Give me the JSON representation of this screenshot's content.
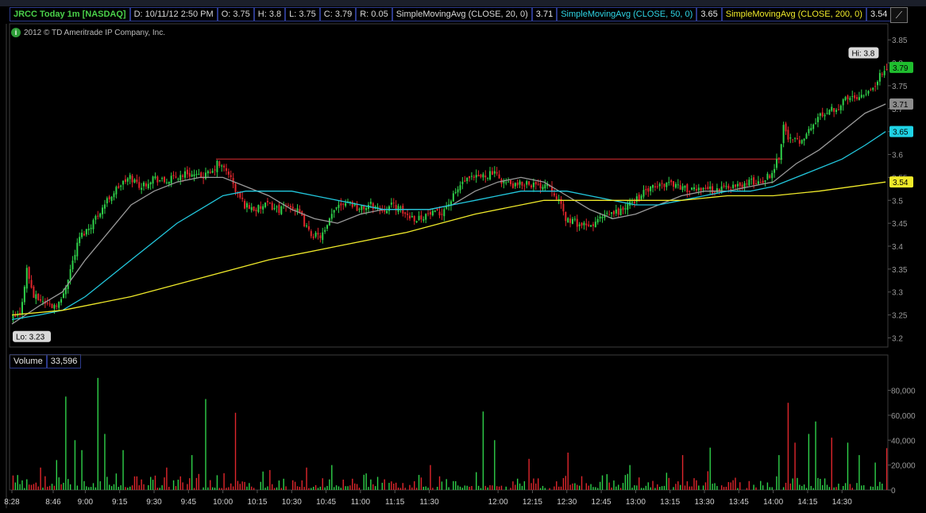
{
  "header": {
    "symbol_label": "JRCC Today 1m [NASDAQ]",
    "date_time": "D: 10/11/12 2:50 PM",
    "open": "O: 3.75",
    "high": "H: 3.8",
    "low": "L: 3.75",
    "close": "C: 3.79",
    "range": "R: 0.05",
    "sma20_label": "SimpleMovingAvg (CLOSE, 20, 0)",
    "sma20_value": "3.71",
    "sma50_label": "SimpleMovingAvg (CLOSE, 50, 0)",
    "sma50_value": "3.65",
    "sma200_label": "SimpleMovingAvg (CLOSE, 200, 0)",
    "sma200_value": "3.54"
  },
  "copyright": "2012 © TD Ameritrade IP Company, Inc.",
  "volume_header": {
    "label": "Volume",
    "value": "33,596"
  },
  "colors": {
    "up": "#2fd14a",
    "down": "#e0262c",
    "sma20": "#9a9a9a",
    "sma50": "#22c7dd",
    "sma200": "#f0ea2a",
    "resistance": "#c4282c",
    "grid": "#1f2555",
    "panel_border": "#3c3c3c"
  },
  "chart_data": [
    {
      "type": "line",
      "title": "JRCC Today 1m [NASDAQ]",
      "chart_kind": "candlestick",
      "y_ticks": [
        "3.2",
        "3.25",
        "3.3",
        "3.35",
        "3.4",
        "3.45",
        "3.5",
        "3.55",
        "3.6",
        "3.65",
        "3.7",
        "3.75",
        "3.8",
        "3.85"
      ],
      "ylim": [
        3.18,
        3.885
      ],
      "x_ticks": [
        "8:28",
        "8:46",
        "9:00",
        "9:15",
        "9:30",
        "9:45",
        "10:00",
        "10:15",
        "10:30",
        "10:45",
        "11:00",
        "11:15",
        "11:30",
        "12:00",
        "12:15",
        "12:30",
        "12:45",
        "13:00",
        "13:15",
        "13:30",
        "13:45",
        "14:00",
        "14:15",
        "14:30"
      ],
      "x_tick_minutes": [
        508,
        526,
        540,
        555,
        570,
        585,
        600,
        615,
        630,
        645,
        660,
        675,
        690,
        720,
        735,
        750,
        765,
        780,
        795,
        810,
        825,
        840,
        855,
        870
      ],
      "xlim_minutes": [
        508,
        890
      ],
      "hi_label": "Hi: 3.8",
      "lo_label": "Lo: 3.23",
      "last_price": "3.79",
      "resistance_level": 3.59,
      "resistance_span_minutes": [
        597,
        844
      ],
      "series": [
        {
          "name": "Close",
          "kind": "price",
          "anchors": [
            [
              508,
              3.24
            ],
            [
              512,
              3.25
            ],
            [
              515,
              3.35
            ],
            [
              518,
              3.29
            ],
            [
              522,
              3.28
            ],
            [
              526,
              3.27
            ],
            [
              530,
              3.28
            ],
            [
              534,
              3.35
            ],
            [
              538,
              3.42
            ],
            [
              542,
              3.44
            ],
            [
              546,
              3.47
            ],
            [
              550,
              3.5
            ],
            [
              555,
              3.53
            ],
            [
              560,
              3.55
            ],
            [
              565,
              3.53
            ],
            [
              570,
              3.55
            ],
            [
              575,
              3.54
            ],
            [
              580,
              3.55
            ],
            [
              585,
              3.56
            ],
            [
              590,
              3.55
            ],
            [
              596,
              3.56
            ],
            [
              598,
              3.58
            ],
            [
              603,
              3.56
            ],
            [
              606,
              3.52
            ],
            [
              610,
              3.49
            ],
            [
              615,
              3.48
            ],
            [
              620,
              3.49
            ],
            [
              625,
              3.48
            ],
            [
              630,
              3.49
            ],
            [
              634,
              3.47
            ],
            [
              638,
              3.43
            ],
            [
              642,
              3.42
            ],
            [
              645,
              3.43
            ],
            [
              650,
              3.49
            ],
            [
              655,
              3.5
            ],
            [
              660,
              3.48
            ],
            [
              665,
              3.49
            ],
            [
              670,
              3.48
            ],
            [
              675,
              3.49
            ],
            [
              680,
              3.47
            ],
            [
              685,
              3.46
            ],
            [
              690,
              3.47
            ],
            [
              695,
              3.47
            ],
            [
              700,
              3.5
            ],
            [
              705,
              3.54
            ],
            [
              712,
              3.55
            ],
            [
              718,
              3.56
            ],
            [
              723,
              3.54
            ],
            [
              728,
              3.53
            ],
            [
              733,
              3.54
            ],
            [
              738,
              3.53
            ],
            [
              742,
              3.54
            ],
            [
              746,
              3.51
            ],
            [
              750,
              3.46
            ],
            [
              755,
              3.45
            ],
            [
              760,
              3.44
            ],
            [
              765,
              3.46
            ],
            [
              770,
              3.47
            ],
            [
              775,
              3.48
            ],
            [
              780,
              3.5
            ],
            [
              785,
              3.52
            ],
            [
              790,
              3.53
            ],
            [
              795,
              3.54
            ],
            [
              800,
              3.53
            ],
            [
              805,
              3.52
            ],
            [
              810,
              3.53
            ],
            [
              815,
              3.52
            ],
            [
              820,
              3.53
            ],
            [
              825,
              3.53
            ],
            [
              830,
              3.54
            ],
            [
              835,
              3.54
            ],
            [
              840,
              3.56
            ],
            [
              843,
              3.6
            ],
            [
              845,
              3.66
            ],
            [
              848,
              3.63
            ],
            [
              852,
              3.63
            ],
            [
              856,
              3.65
            ],
            [
              860,
              3.68
            ],
            [
              865,
              3.7
            ],
            [
              868,
              3.7
            ],
            [
              872,
              3.72
            ],
            [
              878,
              3.73
            ],
            [
              882,
              3.74
            ],
            [
              886,
              3.76
            ],
            [
              889,
              3.79
            ]
          ]
        },
        {
          "name": "SimpleMovingAvg (CLOSE, 20, 0)",
          "value": "3.71",
          "anchors": [
            [
              508,
              3.23
            ],
            [
              520,
              3.27
            ],
            [
              530,
              3.3
            ],
            [
              540,
              3.37
            ],
            [
              550,
              3.43
            ],
            [
              560,
              3.49
            ],
            [
              570,
              3.52
            ],
            [
              580,
              3.54
            ],
            [
              590,
              3.55
            ],
            [
              600,
              3.55
            ],
            [
              610,
              3.53
            ],
            [
              620,
              3.51
            ],
            [
              630,
              3.48
            ],
            [
              640,
              3.46
            ],
            [
              650,
              3.45
            ],
            [
              660,
              3.47
            ],
            [
              670,
              3.48
            ],
            [
              680,
              3.48
            ],
            [
              690,
              3.48
            ],
            [
              700,
              3.49
            ],
            [
              710,
              3.52
            ],
            [
              720,
              3.54
            ],
            [
              730,
              3.55
            ],
            [
              740,
              3.54
            ],
            [
              750,
              3.51
            ],
            [
              760,
              3.48
            ],
            [
              770,
              3.46
            ],
            [
              780,
              3.47
            ],
            [
              790,
              3.49
            ],
            [
              800,
              3.51
            ],
            [
              810,
              3.52
            ],
            [
              820,
              3.52
            ],
            [
              830,
              3.53
            ],
            [
              840,
              3.54
            ],
            [
              850,
              3.58
            ],
            [
              860,
              3.61
            ],
            [
              870,
              3.65
            ],
            [
              880,
              3.69
            ],
            [
              889,
              3.71
            ]
          ]
        },
        {
          "name": "SimpleMovingAvg (CLOSE, 50, 0)",
          "value": "3.65",
          "anchors": [
            [
              508,
              3.24
            ],
            [
              520,
              3.25
            ],
            [
              530,
              3.26
            ],
            [
              540,
              3.29
            ],
            [
              550,
              3.33
            ],
            [
              560,
              3.37
            ],
            [
              570,
              3.41
            ],
            [
              580,
              3.45
            ],
            [
              590,
              3.48
            ],
            [
              600,
              3.51
            ],
            [
              610,
              3.52
            ],
            [
              620,
              3.52
            ],
            [
              630,
              3.52
            ],
            [
              640,
              3.51
            ],
            [
              650,
              3.5
            ],
            [
              660,
              3.49
            ],
            [
              670,
              3.48
            ],
            [
              680,
              3.48
            ],
            [
              690,
              3.48
            ],
            [
              700,
              3.49
            ],
            [
              710,
              3.5
            ],
            [
              720,
              3.51
            ],
            [
              730,
              3.52
            ],
            [
              740,
              3.52
            ],
            [
              750,
              3.52
            ],
            [
              760,
              3.51
            ],
            [
              770,
              3.5
            ],
            [
              780,
              3.49
            ],
            [
              790,
              3.49
            ],
            [
              800,
              3.5
            ],
            [
              810,
              3.51
            ],
            [
              820,
              3.52
            ],
            [
              830,
              3.52
            ],
            [
              840,
              3.53
            ],
            [
              850,
              3.55
            ],
            [
              860,
              3.57
            ],
            [
              870,
              3.59
            ],
            [
              880,
              3.62
            ],
            [
              889,
              3.65
            ]
          ]
        },
        {
          "name": "SimpleMovingAvg (CLOSE, 200, 0)",
          "value": "3.54",
          "anchors": [
            [
              508,
              3.25
            ],
            [
              530,
              3.26
            ],
            [
              560,
              3.29
            ],
            [
              590,
              3.33
            ],
            [
              620,
              3.37
            ],
            [
              650,
              3.4
            ],
            [
              680,
              3.43
            ],
            [
              710,
              3.47
            ],
            [
              740,
              3.5
            ],
            [
              770,
              3.5
            ],
            [
              800,
              3.5
            ],
            [
              820,
              3.51
            ],
            [
              840,
              3.51
            ],
            [
              860,
              3.52
            ],
            [
              889,
              3.54
            ]
          ]
        }
      ]
    },
    {
      "type": "bar",
      "title": "Volume",
      "last_value": "33,596",
      "y_ticks": [
        "0",
        "20,000",
        "40,000",
        "60,000",
        "80,000"
      ],
      "ylim": [
        0,
        95000
      ],
      "spikes": [
        [
          510,
          12000
        ],
        [
          520,
          18000
        ],
        [
          527,
          24000
        ],
        [
          531,
          75000
        ],
        [
          535,
          40000
        ],
        [
          538,
          32000
        ],
        [
          545,
          90000
        ],
        [
          548,
          45000
        ],
        [
          556,
          32000
        ],
        [
          575,
          18000
        ],
        [
          586,
          28000
        ],
        [
          592,
          73000
        ],
        [
          605,
          62000
        ],
        [
          620,
          16000
        ],
        [
          636,
          18000
        ],
        [
          647,
          20000
        ],
        [
          690,
          20000
        ],
        [
          713,
          63000
        ],
        [
          718,
          40000
        ],
        [
          733,
          25000
        ],
        [
          750,
          30000
        ],
        [
          777,
          20000
        ],
        [
          800,
          28000
        ],
        [
          812,
          34000
        ],
        [
          842,
          28000
        ],
        [
          846,
          70000
        ],
        [
          849,
          38000
        ],
        [
          855,
          45000
        ],
        [
          858,
          55000
        ],
        [
          865,
          42000
        ],
        [
          872,
          38000
        ],
        [
          877,
          28000
        ],
        [
          884,
          22000
        ],
        [
          889,
          33596
        ]
      ]
    }
  ]
}
